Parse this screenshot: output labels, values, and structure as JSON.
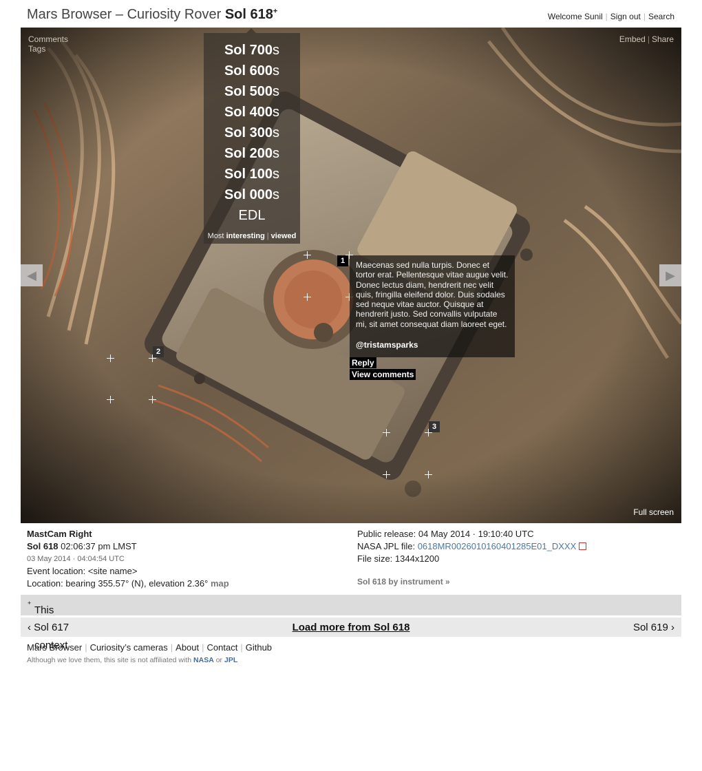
{
  "header": {
    "title_prefix": "Mars Browser – Curiosity Rover ",
    "title_sol": "Sol 618",
    "title_sup": "+",
    "user_nav": [
      "Welcome Sunil",
      "Sign out",
      "Search"
    ]
  },
  "photo_overlay": {
    "top_left": [
      "Comments",
      "Tags"
    ],
    "top_right": [
      "Embed",
      "Share"
    ],
    "fullscreen": "Full screen",
    "prev_icon": "left-triangle-icon",
    "next_icon": "right-triangle-icon"
  },
  "sol_menu": {
    "items": [
      {
        "label": "Sol 700",
        "suffix": "s"
      },
      {
        "label": "Sol 600",
        "suffix": "s"
      },
      {
        "label": "Sol 500",
        "suffix": "s"
      },
      {
        "label": "Sol 400",
        "suffix": "s"
      },
      {
        "label": "Sol 300",
        "suffix": "s"
      },
      {
        "label": "Sol 200",
        "suffix": "s"
      },
      {
        "label": "Sol 100",
        "suffix": "s"
      },
      {
        "label": "Sol 000",
        "suffix": "s"
      }
    ],
    "edl": "EDL",
    "sort_prefix": "Most",
    "sort_interesting": "interesting",
    "sort_viewed": "viewed"
  },
  "annotations": [
    {
      "number": "1"
    },
    {
      "number": "2"
    },
    {
      "number": "3"
    }
  ],
  "comment": {
    "text": "Maecenas sed nulla turpis. Donec et tortor erat. Pellentesque vitae augue velit. Donec lectus diam, hendrerit nec velit quis, fringilla eleifend dolor. Duis sodales sed neque vitae auctor. Quisque at hendrerit justo. Sed convallis vulputate mi, sit amet consequat diam laoreet eget.",
    "author": "@tristamsparks",
    "reply": "Reply",
    "view_comments": "View comments"
  },
  "meta": {
    "camera": "MastCam Right",
    "sol": "Sol 618",
    "lmst": "02:06:37 pm LMST",
    "earth_date": "03 May 2014 · 04:04:54 UTC",
    "event_location": "Event location: <site name>",
    "location": "Location: bearing 355.57° (N), elevation 2.36°",
    "map": "map",
    "public_release": "Public release: 04 May 2014 · 19:10:40 UTC",
    "jpl_label": "NASA JPL file:",
    "jpl_file": "0618MR0026010160401285E01_DXXX",
    "file_size": "File size: 1344x1200",
    "by_instrument": "Sol 618 by instrument »"
  },
  "context": {
    "title": "This photo in context",
    "title_sup": "+",
    "prev": "‹ Sol 617",
    "load_more": "Load more from Sol 618",
    "next": "Sol 619 ›"
  },
  "footer": {
    "nav": [
      "Mars Browser",
      "Curiosity’s cameras",
      "About",
      "Contact",
      "Github"
    ],
    "note_prefix": "Although we love them, this site is not affiliated with",
    "nasa": "NASA",
    "or": "or",
    "jpl": "JPL"
  },
  "colors": {
    "link_blue": "#4a78a8",
    "context_bar": "#dcdcdc",
    "pager_bar": "#e9e9e9"
  }
}
